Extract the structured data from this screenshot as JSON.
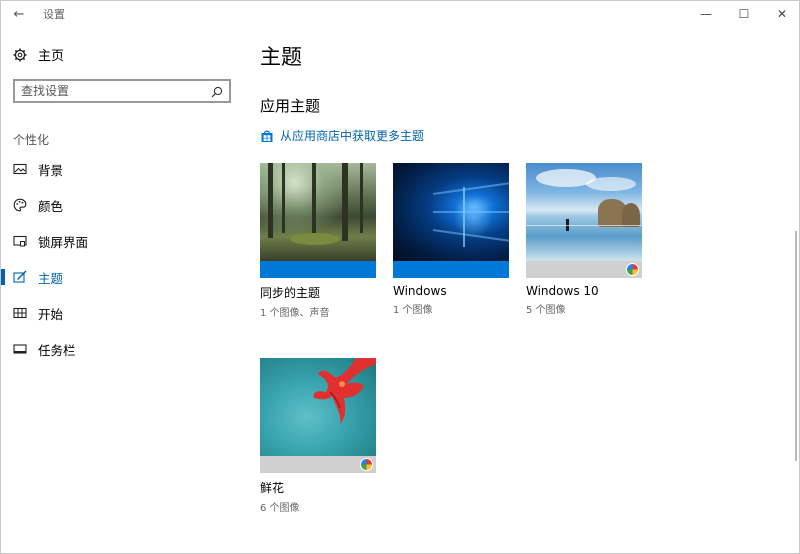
{
  "window": {
    "app_title": "设置",
    "back_label": "←",
    "minimize": "—",
    "maximize": "☐",
    "close": "✕"
  },
  "sidebar": {
    "home_label": "主页",
    "search_placeholder": "查找设置",
    "section_label": "个性化",
    "items": [
      {
        "label": "背景",
        "icon": "picture-icon",
        "active": false
      },
      {
        "label": "颜色",
        "icon": "palette-icon",
        "active": false
      },
      {
        "label": "锁屏界面",
        "icon": "lock-screen-icon",
        "active": false
      },
      {
        "label": "主题",
        "icon": "theme-brush-icon",
        "active": true
      },
      {
        "label": "开始",
        "icon": "start-grid-icon",
        "active": false
      },
      {
        "label": "任务栏",
        "icon": "taskbar-icon",
        "active": false
      }
    ]
  },
  "main": {
    "page_title": "主题",
    "section_title": "应用主题",
    "store_link": "从应用商店中获取更多主题",
    "themes": [
      {
        "name": "同步的主题",
        "meta": "1 个图像、声音",
        "strip_color": "#0078d7",
        "has_color_wheel": false
      },
      {
        "name": "Windows",
        "meta": "1 个图像",
        "strip_color": "#0078d7",
        "has_color_wheel": false
      },
      {
        "name": "Windows 10",
        "meta": "5 个图像",
        "strip_color": "#d0d0d0",
        "has_color_wheel": true
      },
      {
        "name": "鲜花",
        "meta": "6 个图像",
        "strip_color": "#d0d0d0",
        "has_color_wheel": true
      }
    ]
  },
  "colors": {
    "accent": "#0063b1",
    "tile_blue": "#0078d7",
    "tile_gray": "#d0d0d0"
  }
}
